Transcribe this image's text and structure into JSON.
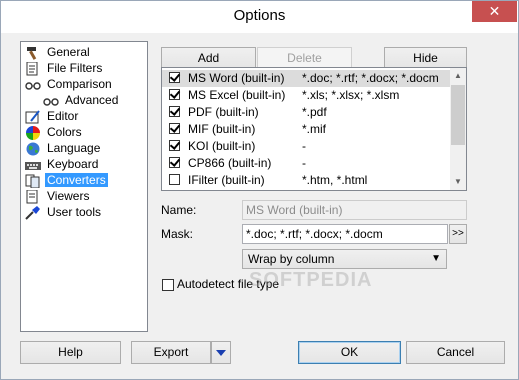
{
  "window": {
    "title": "Options"
  },
  "titlebar": {
    "close_glyph": "✕"
  },
  "tree": {
    "items": [
      {
        "label": "General",
        "icon": "hammer-icon"
      },
      {
        "label": "File Filters",
        "icon": "file-filter-icon"
      },
      {
        "label": "Comparison",
        "icon": "glasses-icon"
      },
      {
        "label": "Advanced",
        "icon": "glasses-icon"
      },
      {
        "label": "Editor",
        "icon": "editor-icon"
      },
      {
        "label": "Colors",
        "icon": "color-wheel-icon"
      },
      {
        "label": "Language",
        "icon": "globe-icon"
      },
      {
        "label": "Keyboard",
        "icon": "keyboard-icon"
      },
      {
        "label": "Converters",
        "icon": "converter-icon",
        "selected": true
      },
      {
        "label": "Viewers",
        "icon": "viewer-icon"
      },
      {
        "label": "User tools",
        "icon": "user-tools-icon"
      }
    ]
  },
  "toolbar": {
    "add": "Add",
    "delete": "Delete",
    "hide": "Hide"
  },
  "converters": {
    "rows": [
      {
        "name": "MS Word (built-in)",
        "ext": "*.doc; *.rtf; *.docx; *.docm",
        "checked": true,
        "selected": true
      },
      {
        "name": "MS Excel (built-in)",
        "ext": "*.xls; *.xlsx; *.xlsm",
        "checked": true
      },
      {
        "name": "PDF (built-in)",
        "ext": "*.pdf",
        "checked": true
      },
      {
        "name": "MIF (built-in)",
        "ext": "*.mif",
        "checked": true
      },
      {
        "name": "KOI (built-in)",
        "ext": "-",
        "checked": true
      },
      {
        "name": "CP866 (built-in)",
        "ext": "-",
        "checked": true
      },
      {
        "name": "IFilter (built-in)",
        "ext": "*.htm, *.html",
        "checked": false
      }
    ]
  },
  "form": {
    "name_label": "Name:",
    "name_value": "MS Word (built-in)",
    "mask_label": "Mask:",
    "mask_value": "*.doc; *.rtf; *.docx; *.docm",
    "mask_button": ">>",
    "wrap_value": "Wrap by column",
    "autodetect_label": "Autodetect file type"
  },
  "footer": {
    "help": "Help",
    "export": "Export",
    "ok": "OK",
    "cancel": "Cancel"
  },
  "watermark": "SOFTPEDIA"
}
